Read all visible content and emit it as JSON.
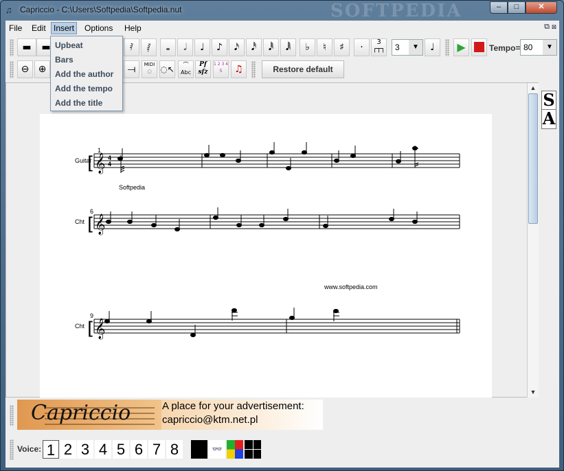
{
  "window": {
    "title": "Capriccio - C:\\Users\\Softpedia\\Softpedia.nut",
    "watermark": "SOFTPEDIA",
    "minimize": "–",
    "maximize": "□",
    "close": "✕"
  },
  "menubar": [
    "File",
    "Edit",
    "Insert",
    "Options",
    "Help"
  ],
  "insert_menu": [
    "Upbeat",
    "Bars",
    "Add the author",
    "Add the tempo",
    "Add the title"
  ],
  "toolbar1": {
    "tuplet_value": "3",
    "tuplet_top": "3",
    "tempo_label": "Tempo=",
    "tempo_value": "80"
  },
  "toolbar2": {
    "restore_default": "Restore default",
    "midi_label": "MIDI",
    "abc_label": "Abc",
    "dyn_p": "P",
    "dyn_f": "f",
    "dyn_sfz": "sfz",
    "fingering": "1 2 3 4 5"
  },
  "score": {
    "systems": [
      {
        "instrument": "Guitar",
        "bar_number": "1",
        "time_sig": [
          "4",
          "4"
        ]
      },
      {
        "instrument": "Cht",
        "bar_number": "6"
      },
      {
        "instrument": "Cht",
        "bar_number": "9"
      }
    ],
    "text_softpedia": "Softpedia",
    "text_url": "www.softpedia.com"
  },
  "side_panel": {
    "s": "S",
    "a": "A"
  },
  "ad": {
    "brand": "Capriccio",
    "line1": "A place for your advertisement:",
    "line2": "capriccio@ktm.net.pl"
  },
  "voices": {
    "label": "Voice:",
    "numbers": [
      "1",
      "2",
      "3",
      "4",
      "5",
      "6",
      "7",
      "8"
    ]
  },
  "colors": {
    "play": "#2fa43a",
    "stop": "#d01a1a",
    "titlebar": "#4f6f8f"
  }
}
